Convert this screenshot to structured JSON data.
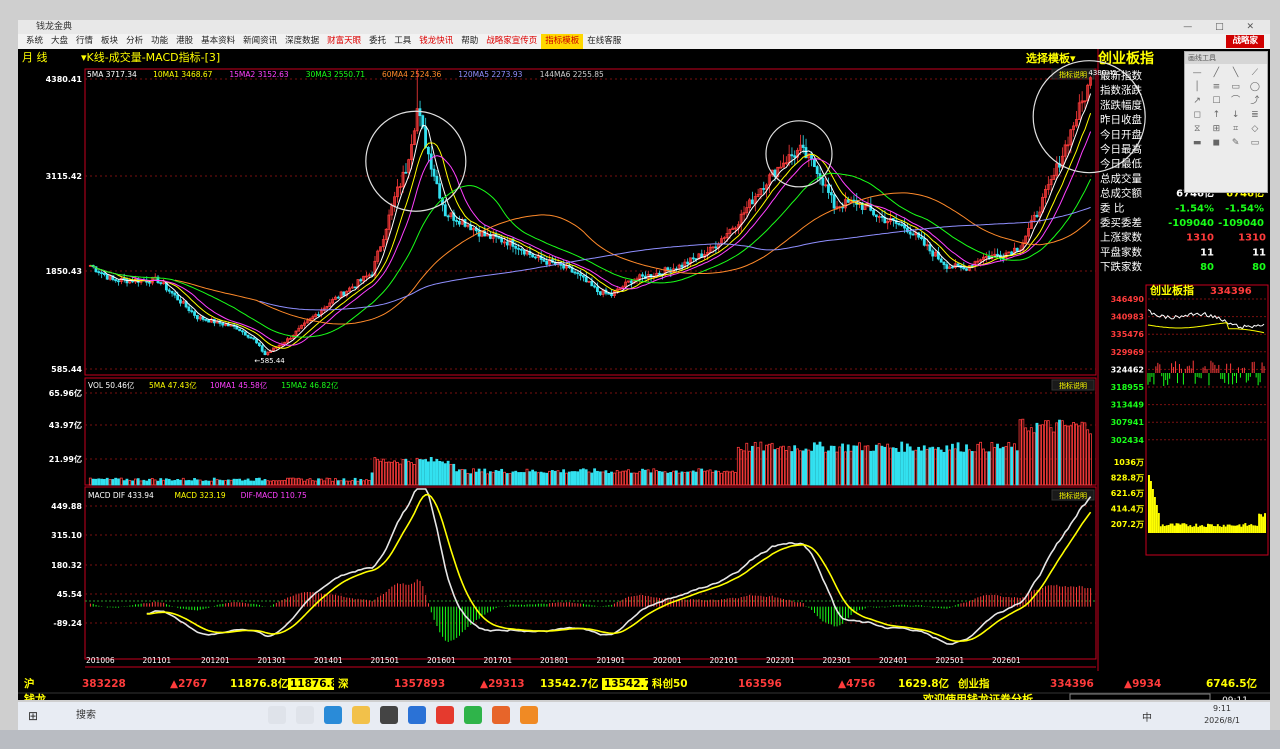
{
  "titlebar": {
    "app_title": "钱龙金典",
    "win_controls": "— □ ✕"
  },
  "menu": [
    "系统",
    "大盘",
    "行情",
    "板块",
    "分析",
    "功能",
    "港股",
    "基本资料",
    "新闻资讯",
    "深度数据",
    "财富天眼",
    "委托",
    "工具",
    "钱龙快讯",
    "帮助",
    "战略家宣传页",
    "指标模板",
    "在线客服"
  ],
  "menu_brand": "战略家",
  "header": {
    "period": "月 线",
    "chart_title": "K线-成交量-MACD指标-[3]",
    "template_btn": "选择模板",
    "index_name": "创业板指"
  },
  "colors": {
    "up": "#ff3b3b",
    "down": "#33e1f0",
    "bg": "#000000",
    "border": "#c8001e",
    "yellow": "#ffff00",
    "white": "#ffffff",
    "green": "#19ff19",
    "magenta": "#ff40ff"
  },
  "ma_legend": [
    {
      "label": "5MA 3717.34",
      "color": "#ffffff"
    },
    {
      "label": "10MA1 3468.67",
      "color": "#ffff00"
    },
    {
      "label": "15MA2 3152.63",
      "color": "#ff40ff"
    },
    {
      "label": "30MA3 2550.71",
      "color": "#19ff19"
    },
    {
      "label": "60MA4 2524.36",
      "color": "#ff8a2a"
    },
    {
      "label": "120MA5 2273.93",
      "color": "#8f8fff"
    },
    {
      "label": "144MA6 2255.85",
      "color": "#cccccc"
    }
  ],
  "vol_legend": [
    {
      "label": "VOL 50.46亿",
      "color": "#ffffff"
    },
    {
      "label": "5MA 47.43亿",
      "color": "#ffff00"
    },
    {
      "label": "10MA1 45.58亿",
      "color": "#ff40ff"
    },
    {
      "label": "15MA2 46.82亿",
      "color": "#19ff19"
    }
  ],
  "macd_legend": [
    {
      "label": "MACD DIF 433.94",
      "color": "#ffffff"
    },
    {
      "label": "MACD 323.19",
      "color": "#ffff00"
    },
    {
      "label": "DIF-MACD 110.75",
      "color": "#ff40ff"
    }
  ],
  "indicator_btn": "指标说明",
  "price_axis": [
    "4380.41",
    "3115.42",
    "1850.43",
    "585.44"
  ],
  "vol_axis": [
    "65.96亿",
    "43.97亿",
    "21.99亿"
  ],
  "macd_axis": [
    "449.88",
    "315.10",
    "180.32",
    "45.54",
    "-89.24"
  ],
  "x_axis": [
    "201006",
    "201101",
    "201201",
    "201301",
    "201401",
    "201501",
    "201601",
    "201701",
    "201801",
    "201901",
    "202001",
    "202101",
    "202201",
    "202301",
    "202401",
    "202501",
    "202601"
  ],
  "annotations": {
    "high_label": "4380.41",
    "low_label": "585.44"
  },
  "quote": {
    "rows": [
      {
        "label": "最新指数",
        "value": "",
        "value2": ""
      },
      {
        "label": "指数涨跌",
        "value": "",
        "value2": ""
      },
      {
        "label": "涨跌幅度",
        "value": "",
        "value2": ""
      },
      {
        "label": "昨日收盘",
        "value": "",
        "value2": ""
      },
      {
        "label": "今日开盘",
        "value": "",
        "value2": ""
      },
      {
        "label": "今日最高",
        "value": "",
        "value2": ""
      },
      {
        "label": "今日最低",
        "value": "",
        "value2": ""
      },
      {
        "label": "总成交量",
        "value": "",
        "value2": ""
      },
      {
        "label": "总成交额",
        "value": "6746亿",
        "value2": ""
      },
      {
        "label": "委 比",
        "value": "-1.54%",
        "value2": ""
      },
      {
        "label": "委买委差",
        "value": "-109040",
        "value2": ""
      },
      {
        "label": "上涨家数",
        "value": "1310",
        "value2": "1310"
      },
      {
        "label": "平盘家数",
        "value": "11",
        "value2": "11"
      },
      {
        "label": "下跌家数",
        "value": "80",
        "value2": "80"
      }
    ]
  },
  "intraday": {
    "title": "创业板指",
    "last": "334396",
    "price_axis": [
      "346490",
      "340983",
      "335476",
      "329969",
      "324462",
      "318955",
      "313449",
      "307941",
      "302434"
    ],
    "vol_axis": [
      "1036万",
      "828.8万",
      "621.6万",
      "414.4万",
      "207.2万"
    ]
  },
  "tool_panel": {
    "title": "画线工具"
  },
  "status_bar": {
    "sh_label": "沪",
    "sh_value": "383228",
    "sh_change": "▲2767",
    "sh_amount": "11876.8亿",
    "sh_amount_box": "11876.8亿",
    "sz_label": "深",
    "sz_value": "1357893",
    "sz_change": "▲29313",
    "sz_amount": "13542.7亿",
    "sz_amount_box": "13542.7亿",
    "kc_label": "科创50",
    "kc_value": "163596",
    "kc_change": "▲4756",
    "kc_amount": "1629.8亿",
    "cy_label": "创业指",
    "cy_value": "334396",
    "cy_change": "▲9934",
    "cy_amount": "6746.5亿"
  },
  "bottom": {
    "logo": "钱龙",
    "welcome": "欢迎使用钱龙证券分析",
    "time": "09:11"
  },
  "taskbar": {
    "search": "搜索",
    "time": "9:11",
    "date": "2026/8/1",
    "ime": "中"
  }
}
